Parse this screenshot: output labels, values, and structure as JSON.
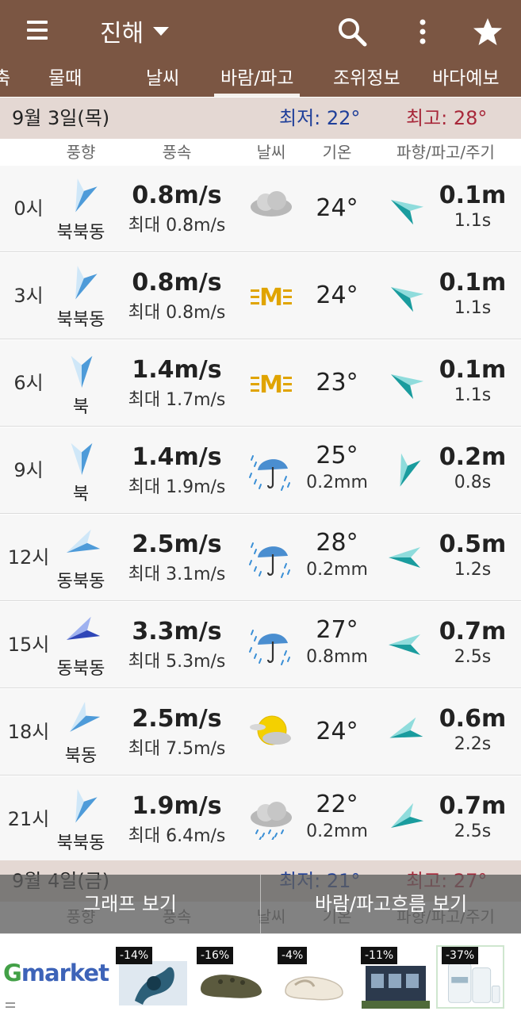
{
  "header": {
    "location": "진해",
    "icons": [
      "menu-icon",
      "caret-down-icon",
      "search-icon",
      "more-vert-icon",
      "star-icon"
    ]
  },
  "tabs": [
    {
      "label": "축",
      "active": false
    },
    {
      "label": "물때",
      "active": false
    },
    {
      "label": "날씨",
      "active": false
    },
    {
      "label": "바람/파고",
      "active": true
    },
    {
      "label": "조위정보",
      "active": false
    },
    {
      "label": "바다예보",
      "active": false
    }
  ],
  "columns": [
    "풍향",
    "풍속",
    "날씨",
    "기온",
    "파향/파고/주기"
  ],
  "days": [
    {
      "date": "9월 3일(목)",
      "low": "최저: 22°",
      "high": "최고: 28°",
      "rows": [
        {
          "hour": "0시",
          "dir_label": "북북동",
          "dir_deg": 202,
          "speed": "0.8m/s",
          "gust": "최대 0.8m/s",
          "weather": "cloud-icon",
          "temp": "24°",
          "rain": "",
          "wave_deg": 300,
          "wave_h": "0.1m",
          "wave_p": "1.1s"
        },
        {
          "hour": "3시",
          "dir_label": "북북동",
          "dir_deg": 202,
          "speed": "0.8m/s",
          "gust": "최대 0.8m/s",
          "weather": "haze-icon",
          "temp": "24°",
          "rain": "",
          "wave_deg": 300,
          "wave_h": "0.1m",
          "wave_p": "1.1s"
        },
        {
          "hour": "6시",
          "dir_label": "북",
          "dir_deg": 180,
          "speed": "1.4m/s",
          "gust": "최대 1.7m/s",
          "weather": "haze-icon",
          "temp": "23°",
          "rain": "",
          "wave_deg": 300,
          "wave_h": "0.1m",
          "wave_p": "1.1s"
        },
        {
          "hour": "9시",
          "dir_label": "북",
          "dir_deg": 180,
          "speed": "1.4m/s",
          "gust": "최대 1.9m/s",
          "weather": "umbrella-rain-icon",
          "temp": "25°",
          "rain": "0.2mm",
          "wave_deg": 200,
          "wave_h": "0.2m",
          "wave_p": "0.8s"
        },
        {
          "hour": "12시",
          "dir_label": "동북동",
          "dir_deg": 245,
          "speed": "2.5m/s",
          "gust": "최대 3.1m/s",
          "weather": "umbrella-rain-icon",
          "temp": "28°",
          "rain": "0.2mm",
          "wave_deg": 270,
          "wave_h": "0.5m",
          "wave_p": "1.2s"
        },
        {
          "hour": "15시",
          "dir_label": "동북동",
          "dir_deg": 245,
          "speed": "3.3m/s",
          "gust": "최대 5.3m/s",
          "weather": "umbrella-rain-icon",
          "temp": "27°",
          "rain": "0.8mm",
          "wave_deg": 270,
          "wave_h": "0.7m",
          "wave_p": "2.5s"
        },
        {
          "hour": "18시",
          "dir_label": "북동",
          "dir_deg": 225,
          "speed": "2.5m/s",
          "gust": "최대 7.5m/s",
          "weather": "sun-cloud-icon",
          "temp": "24°",
          "rain": "",
          "wave_deg": 250,
          "wave_h": "0.6m",
          "wave_p": "2.2s"
        },
        {
          "hour": "21시",
          "dir_label": "북북동",
          "dir_deg": 202,
          "speed": "1.9m/s",
          "gust": "최대 6.4m/s",
          "weather": "cloud-rain-icon",
          "temp": "22°",
          "rain": "0.2mm",
          "wave_deg": 240,
          "wave_h": "0.7m",
          "wave_p": "2.5s"
        }
      ]
    },
    {
      "date": "9월 4일(금)",
      "low": "최저: 21°",
      "high": "최고: 27°"
    }
  ],
  "actions": {
    "graph": "그래프 보기",
    "flow": "바람/파고흐름 보기"
  },
  "ad": {
    "brand_g": "G",
    "brand_rest": "market",
    "products": [
      {
        "discount": "-14%",
        "icon": "fidget-spinner-icon"
      },
      {
        "discount": "-16%",
        "icon": "clog-shoe-icon"
      },
      {
        "discount": "-4%",
        "icon": "white-clog-icon"
      },
      {
        "discount": "-11%",
        "icon": "tiny-house-icon"
      },
      {
        "discount": "-37%",
        "icon": "cosmetics-bottle-icon"
      }
    ]
  },
  "colors": {
    "bar": "#7b5643",
    "day_header": "#e4d8d3",
    "low": "#1f3f9a",
    "high": "#a8283a",
    "wind_arrow": "#5fa9e0",
    "wind_arrow_dark": "#3a57c8",
    "wave_arrow": "#1aa3a3"
  }
}
